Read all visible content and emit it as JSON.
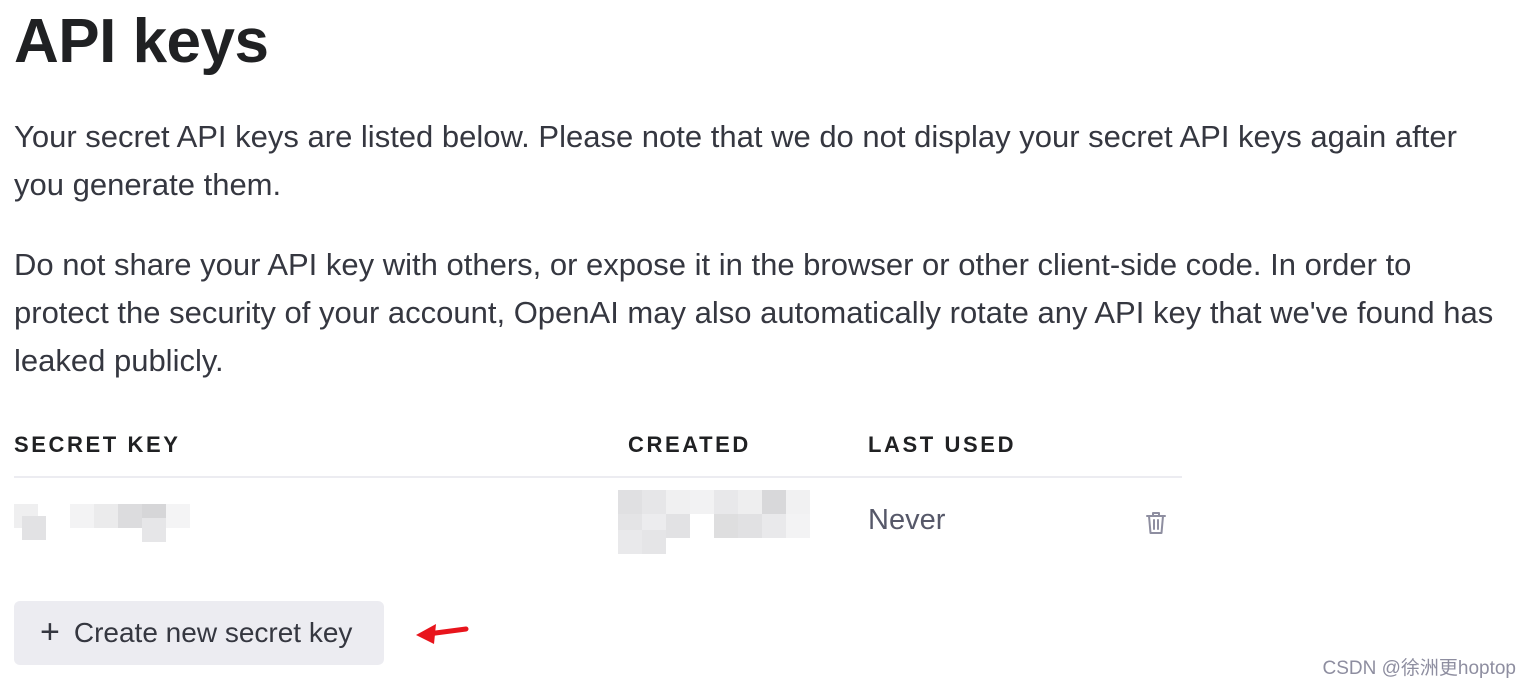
{
  "page": {
    "title": "API keys",
    "intro": "Your secret API keys are listed below. Please note that we do not display your secret API keys again after you generate them.",
    "warning": "Do not share your API key with others, or expose it in the browser or other client-side code. In order to protect the security of your account, OpenAI may also automatically rotate any API key that we've found has leaked publicly."
  },
  "table": {
    "columns": [
      "SECRET KEY",
      "CREATED",
      "LAST USED"
    ],
    "rows": [
      {
        "secret_key": "[redacted]",
        "created": "[redacted]",
        "last_used": "Never",
        "action_icon": "trash-icon"
      }
    ]
  },
  "create_button": {
    "icon": "plus-icon",
    "label": "Create new secret key"
  },
  "annotation": {
    "icon": "red-arrow-icon",
    "color": "#e8141c"
  },
  "watermark": "CSDN @徐洲更hoptop"
}
